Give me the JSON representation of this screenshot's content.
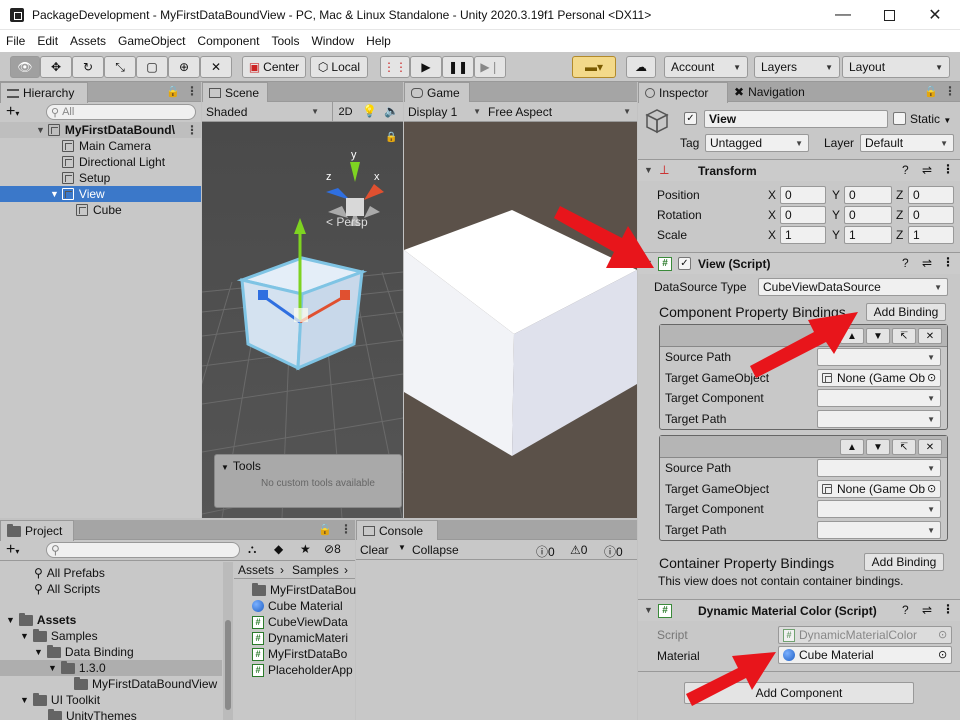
{
  "window": {
    "title": "PackageDevelopment - MyFirstDataBoundView - PC, Mac & Linux Standalone - Unity 2020.3.19f1 Personal <DX11>"
  },
  "menubar": [
    "File",
    "Edit",
    "Assets",
    "GameObject",
    "Component",
    "Tools",
    "Window",
    "Help"
  ],
  "toolbar": {
    "center": "Center",
    "local": "Local",
    "account": "Account",
    "layers": "Layers",
    "layout": "Layout"
  },
  "hierarchy": {
    "tab": "Hierarchy",
    "search_placeholder": "All",
    "scene": "MyFirstDataBound\\",
    "items": [
      "Main Camera",
      "Directional Light",
      "Setup",
      "View",
      "Cube"
    ]
  },
  "scene_view": {
    "tab": "Scene",
    "shading": "Shaded",
    "mode_2d": "2D",
    "persp": "< Persp",
    "tools_title": "Tools",
    "tools_empty": "No custom tools available",
    "axis_x": "x",
    "axis_y": "y",
    "axis_z": "z"
  },
  "game_view": {
    "tab": "Game",
    "display": "Display 1",
    "aspect": "Free Aspect"
  },
  "inspector": {
    "tab": "Inspector",
    "nav_tab": "Navigation",
    "object_name": "View",
    "static_label": "Static",
    "tag_label": "Tag",
    "tag_value": "Untagged",
    "layer_label": "Layer",
    "layer_value": "Default",
    "transform": {
      "title": "Transform",
      "rows": [
        {
          "label": "Position",
          "x": "0",
          "y": "0",
          "z": "0"
        },
        {
          "label": "Rotation",
          "x": "0",
          "y": "0",
          "z": "0"
        },
        {
          "label": "Scale",
          "x": "1",
          "y": "1",
          "z": "1"
        }
      ]
    },
    "xyz": [
      "X",
      "Y",
      "Z"
    ],
    "view_script": {
      "title": "View (Script)",
      "datasource_label": "DataSource Type",
      "datasource_value": "CubeViewDataSource",
      "bindings_title": "Component Property Bindings",
      "add_binding": "Add Binding",
      "binding_rows": [
        "Source Path",
        "Target GameObject",
        "Target Component",
        "Target Path"
      ],
      "none_value": "None (Game Ob",
      "container_title": "Container Property Bindings",
      "container_add": "Add Binding",
      "container_empty": "This view does not contain container bindings."
    },
    "dmc": {
      "title": "Dynamic Material Color (Script)",
      "script_label": "Script",
      "script_value": "DynamicMaterialColor",
      "material_label": "Material",
      "material_value": "Cube Material"
    },
    "add_component": "Add Component"
  },
  "project": {
    "tab": "Project",
    "count": "8",
    "tree": [
      "All Prefabs",
      "All Scripts",
      "Assets",
      "Samples",
      "Data Binding",
      "1.3.0",
      "MyFirstDataBoundView",
      "UI Toolkit",
      "UnityThemes"
    ],
    "breadcrumb": [
      "Assets",
      "Samples"
    ],
    "assets": [
      "MyFirstDataBou",
      "Cube Material",
      "CubeViewData",
      "DynamicMateri",
      "MyFirstDataBo",
      "PlaceholderApp"
    ]
  },
  "console": {
    "tab": "Console",
    "clear": "Clear",
    "collapse": "Collapse",
    "counts": [
      "0",
      "0",
      "0"
    ]
  },
  "colors": {
    "accent": "#3b78c9",
    "arrow": "#e8151b",
    "game_bg": "#5b5149"
  }
}
